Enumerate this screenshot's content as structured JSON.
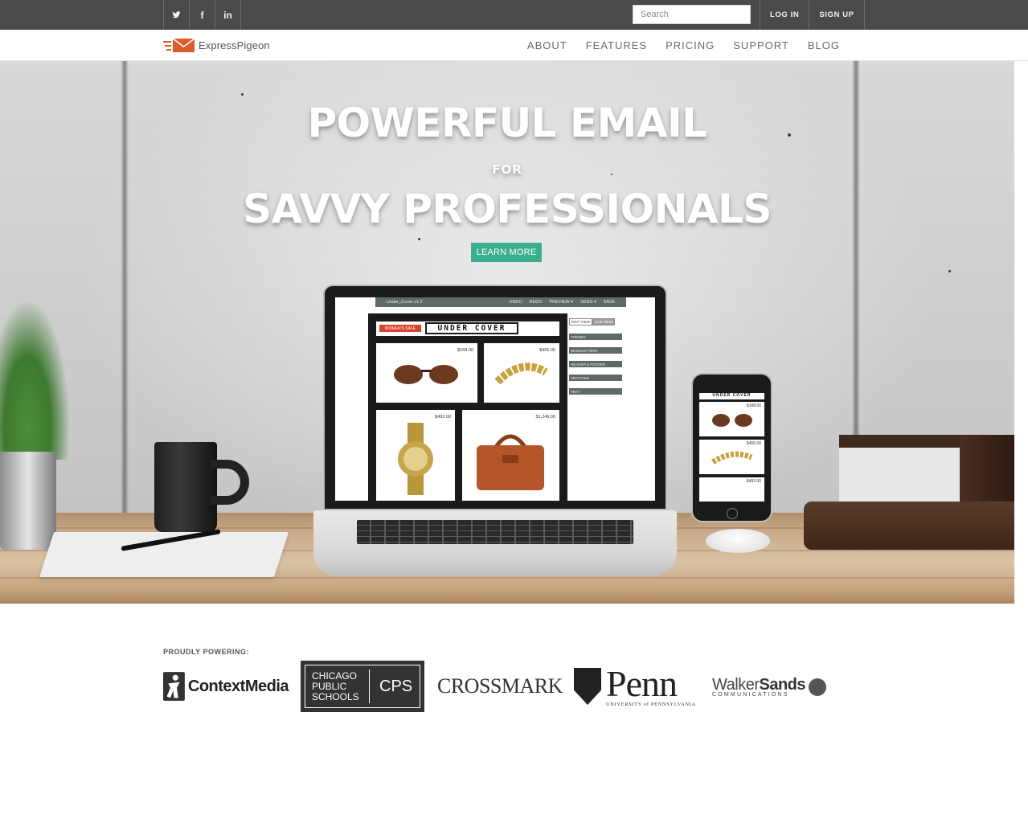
{
  "topbar": {
    "social": [
      {
        "name": "twitter-icon",
        "glyph": "twitter"
      },
      {
        "name": "facebook-icon",
        "glyph": "f"
      },
      {
        "name": "linkedin-icon",
        "glyph": "in"
      }
    ],
    "search": {
      "placeholder": "Search",
      "value": ""
    },
    "login_label": "LOG IN",
    "signup_label": "SIGN UP",
    "background_color": "#4a4a4a"
  },
  "navbar": {
    "logo_text": "ExpressPigeon",
    "logo_color": "#e05a2b",
    "items": [
      {
        "label": "ABOUT"
      },
      {
        "label": "FEATURES"
      },
      {
        "label": "PRICING"
      },
      {
        "label": "SUPPORT"
      },
      {
        "label": "BLOG"
      }
    ]
  },
  "hero": {
    "line1": "POWERFUL EMAIL",
    "line2": "FOR",
    "line3": "SAVVY PROFESSIONALS",
    "cta_label": "LEARN MORE",
    "cta_color": "#3aaf8f",
    "laptop_screen": {
      "doc_title": "Under_Cover v1.2",
      "actions": [
        "UNDO",
        "REDO",
        "PREVIEW ▾",
        "SEND ▾",
        "SAVE"
      ],
      "sale_badge": "WOMEN'S SALE",
      "brand": "UNDER COVER",
      "products": [
        {
          "price": "$168.00",
          "item": "sunglasses"
        },
        {
          "price": "$455.00",
          "item": "bracelet"
        },
        {
          "price": "$492.00",
          "item": "watch"
        },
        {
          "price": "$1,249.00",
          "item": "handbag"
        }
      ],
      "view_tabs": [
        "EDIT VIEW",
        "LIVE VIEW"
      ],
      "tools": [
        "THEMES",
        "NEWSLETTERS",
        "HEADER & FOOTER",
        "SECTIONS",
        "TEXT"
      ]
    },
    "phone_screen": {
      "brand": "UNDER COVER",
      "prices": [
        "$168.00",
        "$455.00",
        "$492.00"
      ]
    }
  },
  "clients": {
    "label": "PROUDLY POWERING:",
    "logos": {
      "contextmedia": "ContextMedia",
      "cps_left": "CHICAGO PUBLIC SCHOOLS",
      "cps_right": "CPS",
      "crossmark": "CROSSMARK",
      "penn": "Penn",
      "penn_sub": "UNIVERSITY of PENNSYLVANIA",
      "walkersands_a": "Walker",
      "walkersands_b": "Sands",
      "walkersands_sub": "COMMUNICATIONS"
    }
  }
}
